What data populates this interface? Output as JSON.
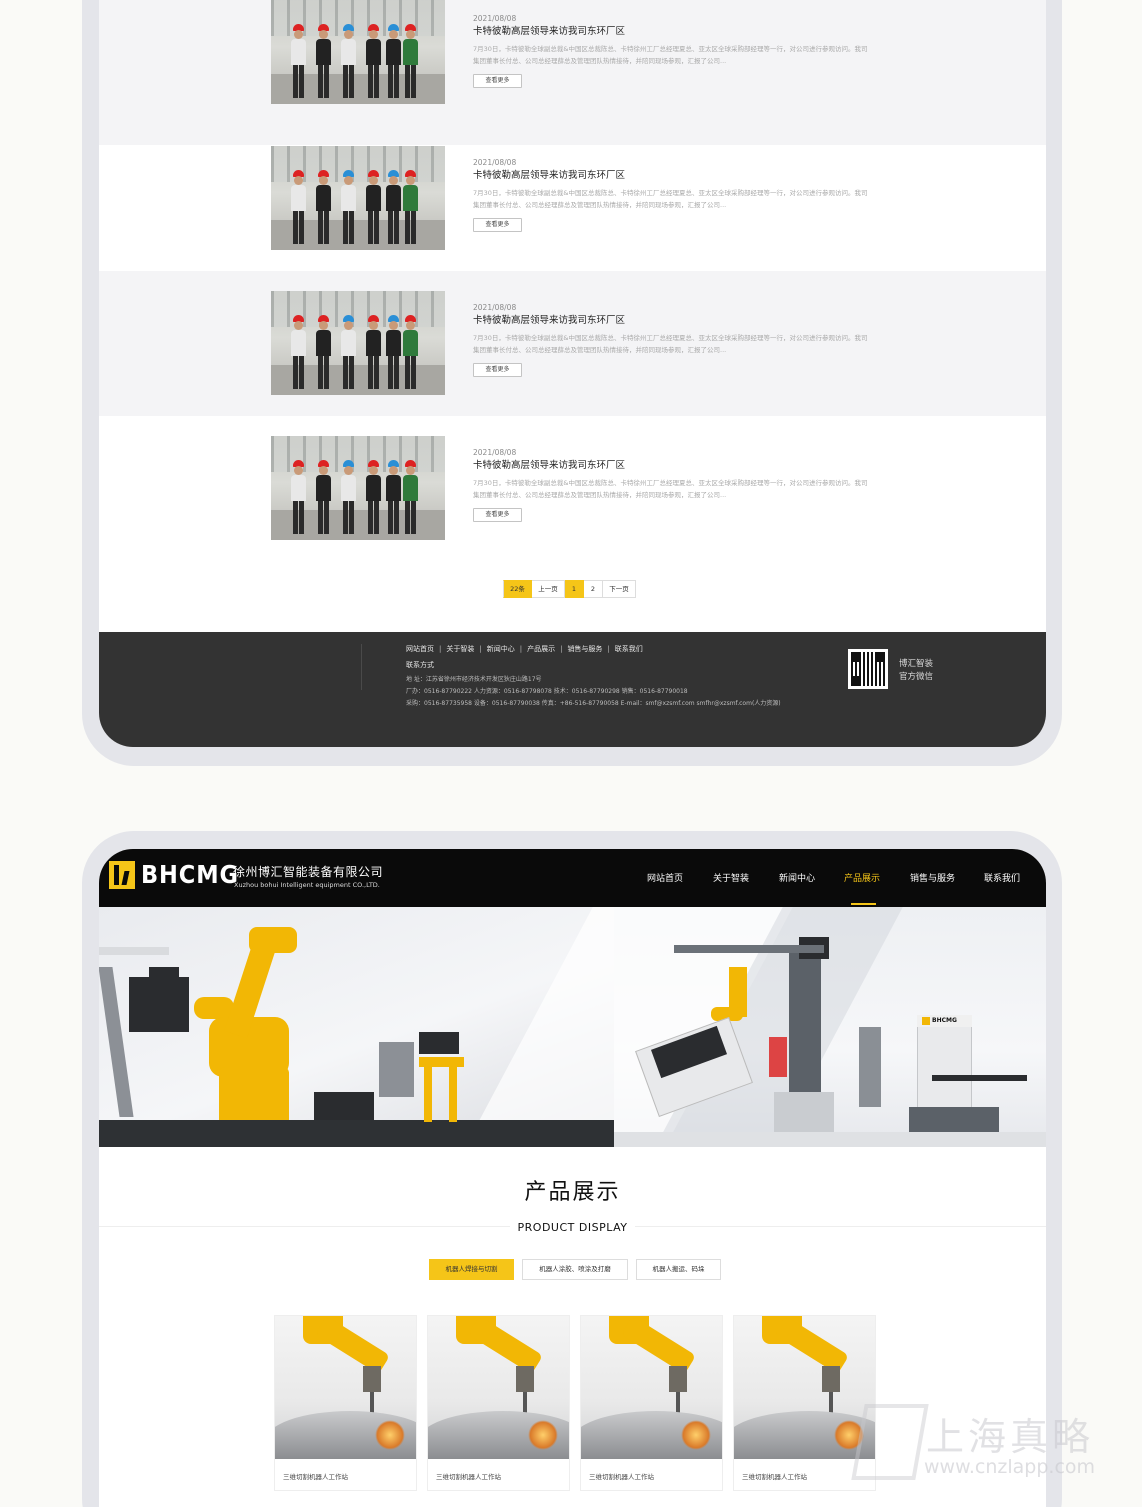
{
  "news": {
    "items": [
      {
        "date": "2021/08/08",
        "title": "卡特彼勒高层领导来访我司东环厂区",
        "desc": "7月30日，卡特彼勒全球副总裁&中国区总裁陈总、卡特徐州工厂总经理夏总、亚太区全球采购部经理等一行，对公司进行参观访问。我司集团董事长付总、公司总经理薛总及管理团队热情接待，并陪同现场参观，汇报了公司...",
        "more": "查看更多"
      },
      {
        "date": "2021/08/08",
        "title": "卡特彼勒高层领导来访我司东环厂区",
        "desc": "7月30日，卡特彼勒全球副总裁&中国区总裁陈总、卡特徐州工厂总经理夏总、亚太区全球采购部经理等一行，对公司进行参观访问。我司集团董事长付总、公司总经理薛总及管理团队热情接待，并陪同现场参观，汇报了公司...",
        "more": "查看更多"
      },
      {
        "date": "2021/08/08",
        "title": "卡特彼勒高层领导来访我司东环厂区",
        "desc": "7月30日，卡特彼勒全球副总裁&中国区总裁陈总、卡特徐州工厂总经理夏总、亚太区全球采购部经理等一行，对公司进行参观访问。我司集团董事长付总、公司总经理薛总及管理团队热情接待，并陪同现场参观，汇报了公司...",
        "more": "查看更多"
      },
      {
        "date": "2021/08/08",
        "title": "卡特彼勒高层领导来访我司东环厂区",
        "desc": "7月30日，卡特彼勒全球副总裁&中国区总裁陈总、卡特徐州工厂总经理夏总、亚太区全球采购部经理等一行，对公司进行参观访问。我司集团董事长付总、公司总经理薛总及管理团队热情接待，并陪同现场参观，汇报了公司...",
        "more": "查看更多"
      }
    ]
  },
  "pagination": {
    "count": "22条",
    "prev": "上一页",
    "pages": [
      "1",
      "2"
    ],
    "current": "1",
    "next": "下一页"
  },
  "footer": {
    "nav": [
      "网站首页",
      "关于智装",
      "新闻中心",
      "产品展示",
      "销售与服务",
      "联系我们"
    ],
    "nav_separator": "|",
    "contact_title": "联系方式",
    "address": "地 址：江苏省徐州市经济技术开发区狄庄山路17号",
    "phones": "厂办：0516-87790222   人力资源：0516-87798078   技术：0516-87790298   销售：0516-87790018",
    "others": "采购：0516-87735958   设备：0516-87790038   传真：+86-516-87790058   E-mail：smf@xzsmf.com   smfhr@xzsmf.com(人力资源)",
    "qr_label_1": "博汇智装",
    "qr_label_2": "官方微信"
  },
  "header": {
    "logo_text": "BHCMG",
    "company_cn": "徐州博汇智能装备有限公司",
    "company_en": "Xuzhou bohui Intelligent equipment CO.,LTD.",
    "nav": [
      "网站首页",
      "关于智装",
      "新闻中心",
      "产品展示",
      "销售与服务",
      "联系我们"
    ],
    "active_nav": "产品展示"
  },
  "banner": {
    "machine_label": "BHCMG"
  },
  "products_section": {
    "title": "产品展示",
    "subtitle": "PRODUCT DISPLAY",
    "tabs": [
      "机器人焊接与切割",
      "机器人涂胶、喷涂及打磨",
      "机器人搬运、码垛"
    ],
    "active_tab": "机器人焊接与切割",
    "items": [
      {
        "name": "三维切割机器人工作站"
      },
      {
        "name": "三维切割机器人工作站"
      },
      {
        "name": "三维切割机器人工作站"
      },
      {
        "name": "三维切割机器人工作站"
      }
    ]
  },
  "watermark": {
    "cn": "上海真略",
    "en": "www.cnzlapp.com"
  },
  "colors": {
    "accent": "#f5c518",
    "header_bg": "#0a0a0a",
    "footer_bg": "#333333",
    "frame": "#e4e5ea"
  }
}
